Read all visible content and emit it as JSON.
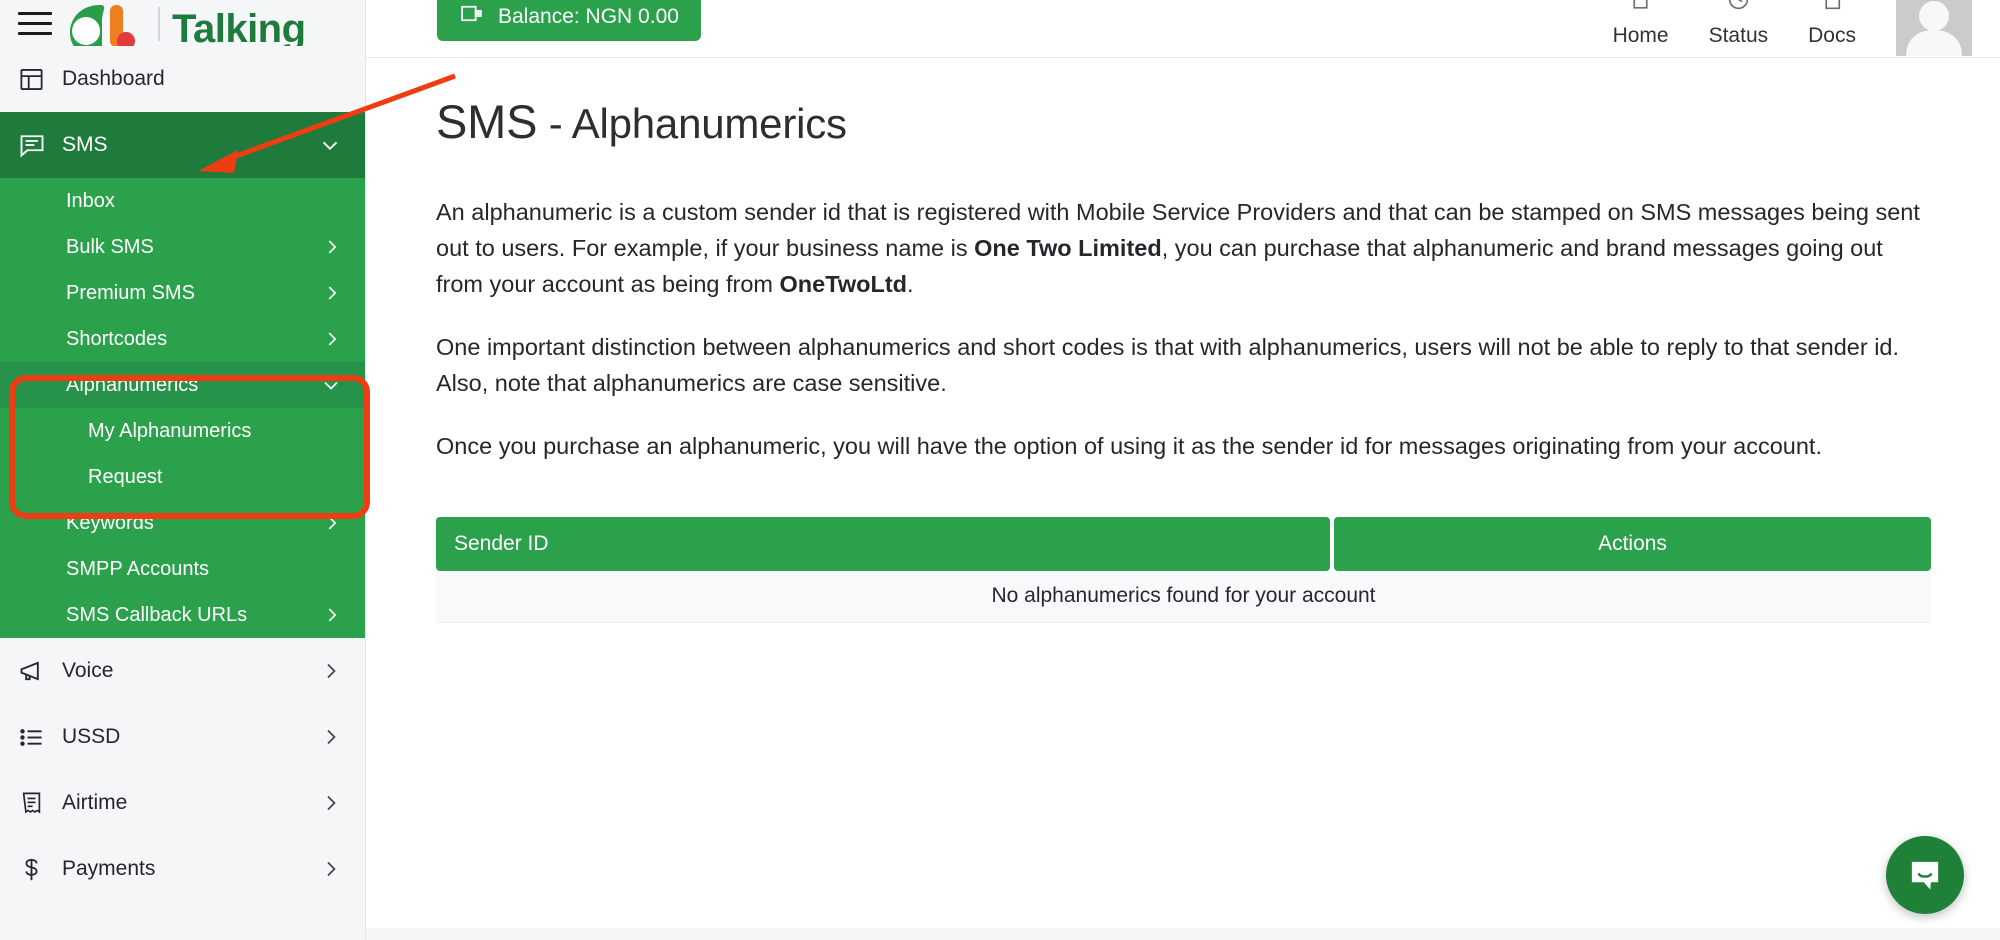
{
  "brand": {
    "name": "Talking",
    "logo_icon": "africas-talking-logo",
    "menu_icon": "hamburger-menu-icon"
  },
  "topbar": {
    "balance_label": "Balance: NGN 0.00",
    "balance_icon": "wallet-icon",
    "links": [
      {
        "label": "Home",
        "icon": "home-icon"
      },
      {
        "label": "Status",
        "icon": "status-icon"
      },
      {
        "label": "Docs",
        "icon": "docs-icon"
      }
    ],
    "avatar_icon": "user-avatar-icon"
  },
  "sidebar": {
    "items": [
      {
        "label": "Dashboard",
        "icon": "dashboard-icon",
        "chevron": "",
        "active": false
      },
      {
        "label": "SMS",
        "icon": "sms-chat-icon",
        "chevron": "down",
        "active": true
      },
      {
        "label": "Voice",
        "icon": "megaphone-icon",
        "chevron": "right",
        "active": false
      },
      {
        "label": "USSD",
        "icon": "list-icon",
        "chevron": "right",
        "active": false
      },
      {
        "label": "Airtime",
        "icon": "receipt-icon",
        "chevron": "right",
        "active": false
      },
      {
        "label": "Payments",
        "icon": "dollar-icon",
        "chevron": "right",
        "active": false
      }
    ],
    "sms_submenu": [
      {
        "label": "Inbox",
        "chevron": ""
      },
      {
        "label": "Bulk SMS",
        "chevron": "right"
      },
      {
        "label": "Premium SMS",
        "chevron": "right"
      },
      {
        "label": "Shortcodes",
        "chevron": "right"
      },
      {
        "label": "Alphanumerics",
        "chevron": "down",
        "expanded": true
      },
      {
        "label": "Keywords",
        "chevron": "right"
      },
      {
        "label": "SMPP Accounts",
        "chevron": ""
      },
      {
        "label": "SMS Callback URLs",
        "chevron": "right"
      }
    ],
    "alphanumerics_submenu": [
      {
        "label": "My Alphanumerics"
      },
      {
        "label": "Request"
      }
    ]
  },
  "main": {
    "title_primary": "SMS",
    "title_secondary": " - Alphanumerics",
    "paragraphs": [
      {
        "parts": [
          {
            "t": "An alphanumeric is a custom sender id that is registered with Mobile Service Providers and that can be stamped on SMS messages being sent out to users. For example, if your business name is ",
            "b": false
          },
          {
            "t": "One Two Limited",
            "b": true
          },
          {
            "t": ", you can purchase that alphanumeric and brand messages going out from your account as being from ",
            "b": false
          },
          {
            "t": "OneTwoLtd",
            "b": true
          },
          {
            "t": ".",
            "b": false
          }
        ]
      },
      {
        "parts": [
          {
            "t": "One important distinction between alphanumerics and short codes is that with alphanumerics, users will not be able to reply to that sender id. Also, note that alphanumerics are case sensitive.",
            "b": false
          }
        ]
      },
      {
        "parts": [
          {
            "t": "Once you purchase an alphanumeric, you will have the option of using it as the sender id for messages originating from your account.",
            "b": false
          }
        ]
      }
    ],
    "table": {
      "columns": [
        "Sender ID",
        "Actions"
      ],
      "rows": [],
      "empty_message": "No alphanumerics found for your account"
    }
  },
  "chat": {
    "icon": "intercom-chat-icon"
  },
  "annotations": {
    "arrow_color": "#f03c12",
    "box_color": "#f03c12",
    "arrow_target": "sms-nav-item",
    "box_target": "alphanumerics-submenu-group"
  },
  "colors": {
    "brand_green": "#1f7a3d",
    "sidebar_active": "#1e7b3c",
    "submenu_green": "#2ba14c",
    "submenu_expanded": "#26924a",
    "sidebar_bg": "#f4f6f7",
    "annotation_red": "#f03c12"
  }
}
